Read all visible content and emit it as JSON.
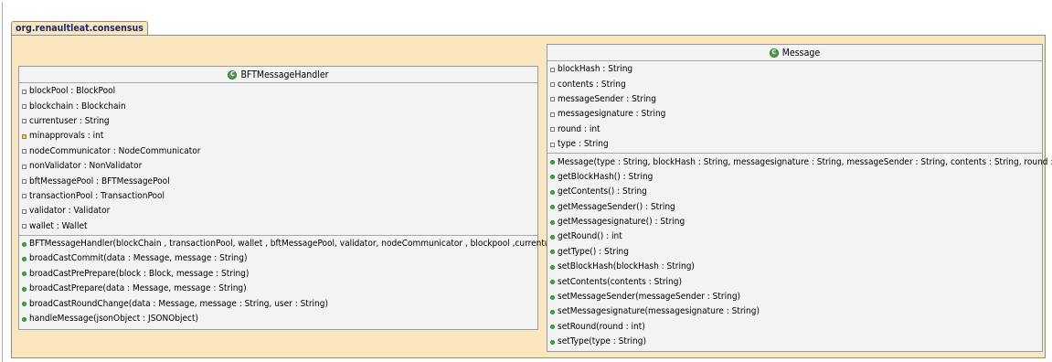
{
  "package": {
    "name": "org.renaultleat.consensus"
  },
  "classes": {
    "bft": {
      "name": "BFTMessageHandler",
      "stereotype_icon": "C",
      "fields": [
        "blockPool : BlockPool",
        "blockchain : Blockchain",
        "currentuser : String",
        "minapprovals : int",
        "nodeCommunicator : NodeCommunicator",
        "nonValidator : NonValidator",
        "bftMessagePool : BFTMessagePool",
        "transactionPool : TransactionPool",
        "validator : Validator",
        "wallet : Wallet"
      ],
      "methods": [
        "BFTMessageHandler(blockChain , transactionPool, wallet , bftMessagePool, validator, nodeCommunicator , blockpool ,currentuser)",
        "broadCastCommit(data : Message, message : String)",
        "broadCastPrePrepare(block : Block, message : String)",
        "broadCastPrepare(data : Message, message : String)",
        "broadCastRoundChange(data : Message, message : String, user : String)",
        "handleMessage(jsonObject : JSONObject)"
      ]
    },
    "message": {
      "name": "Message",
      "stereotype_icon": "C",
      "fields": [
        "blockHash : String",
        "contents : String",
        "messageSender : String",
        "messagesignature : String",
        "round : int",
        "type : String"
      ],
      "methods": [
        "Message(type : String, blockHash : String, messagesignature : String, messageSender : String, contents : String, round : int)",
        "getBlockHash() : String",
        "getContents() : String",
        "getMessageSender() : String",
        "getMessagesignature() : String",
        "getRound() : int",
        "getType() : String",
        "setBlockHash(blockHash : String)",
        "setContents(contents : String)",
        "setMessageSender(messageSender : String)",
        "setMessagesignature(messagesignature : String)",
        "setRound(round : int)",
        "setType(type : String)"
      ]
    }
  }
}
